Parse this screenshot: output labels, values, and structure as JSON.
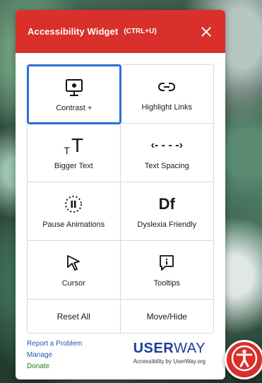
{
  "header": {
    "title": "Accessibility Widget",
    "shortcut": "(CTRL+U)",
    "close_icon": "close-icon"
  },
  "colors": {
    "header_bg": "#d9302b",
    "active_border": "#2a6fd6",
    "brand": "#1c3c9c",
    "link": "#1c58b5",
    "donate": "#1a7d1a"
  },
  "tools": [
    {
      "label": "Contrast +",
      "icon": "contrast-monitor-icon",
      "active": true
    },
    {
      "label": "Highlight Links",
      "icon": "link-icon",
      "active": false
    },
    {
      "label": "Bigger Text",
      "icon": "bigger-text-icon",
      "active": false
    },
    {
      "label": "Text Spacing",
      "icon": "text-spacing-icon",
      "active": false
    },
    {
      "label": "Pause Animations",
      "icon": "pause-icon",
      "active": false
    },
    {
      "label": "Dyslexia Friendly",
      "icon": "dyslexia-font-icon",
      "active": false
    },
    {
      "label": "Cursor",
      "icon": "cursor-icon",
      "active": false
    },
    {
      "label": "Tooltips",
      "icon": "tooltip-icon",
      "active": false
    }
  ],
  "bottom_row": {
    "reset": "Reset All",
    "move": "Move/Hide"
  },
  "footer": {
    "report": "Report a Problem",
    "manage": "Manage",
    "donate": "Donate",
    "brand_bold": "USER",
    "brand_light": "WAY",
    "brand_sub": "Accessibility by UserWay.org"
  },
  "glyphs": {
    "bigger_small": "T",
    "bigger_large": "T",
    "spacing": "‹- - - -›",
    "dyslexia": "Df",
    "pause": "II"
  },
  "floating_button_icon": "accessibility-person-icon"
}
